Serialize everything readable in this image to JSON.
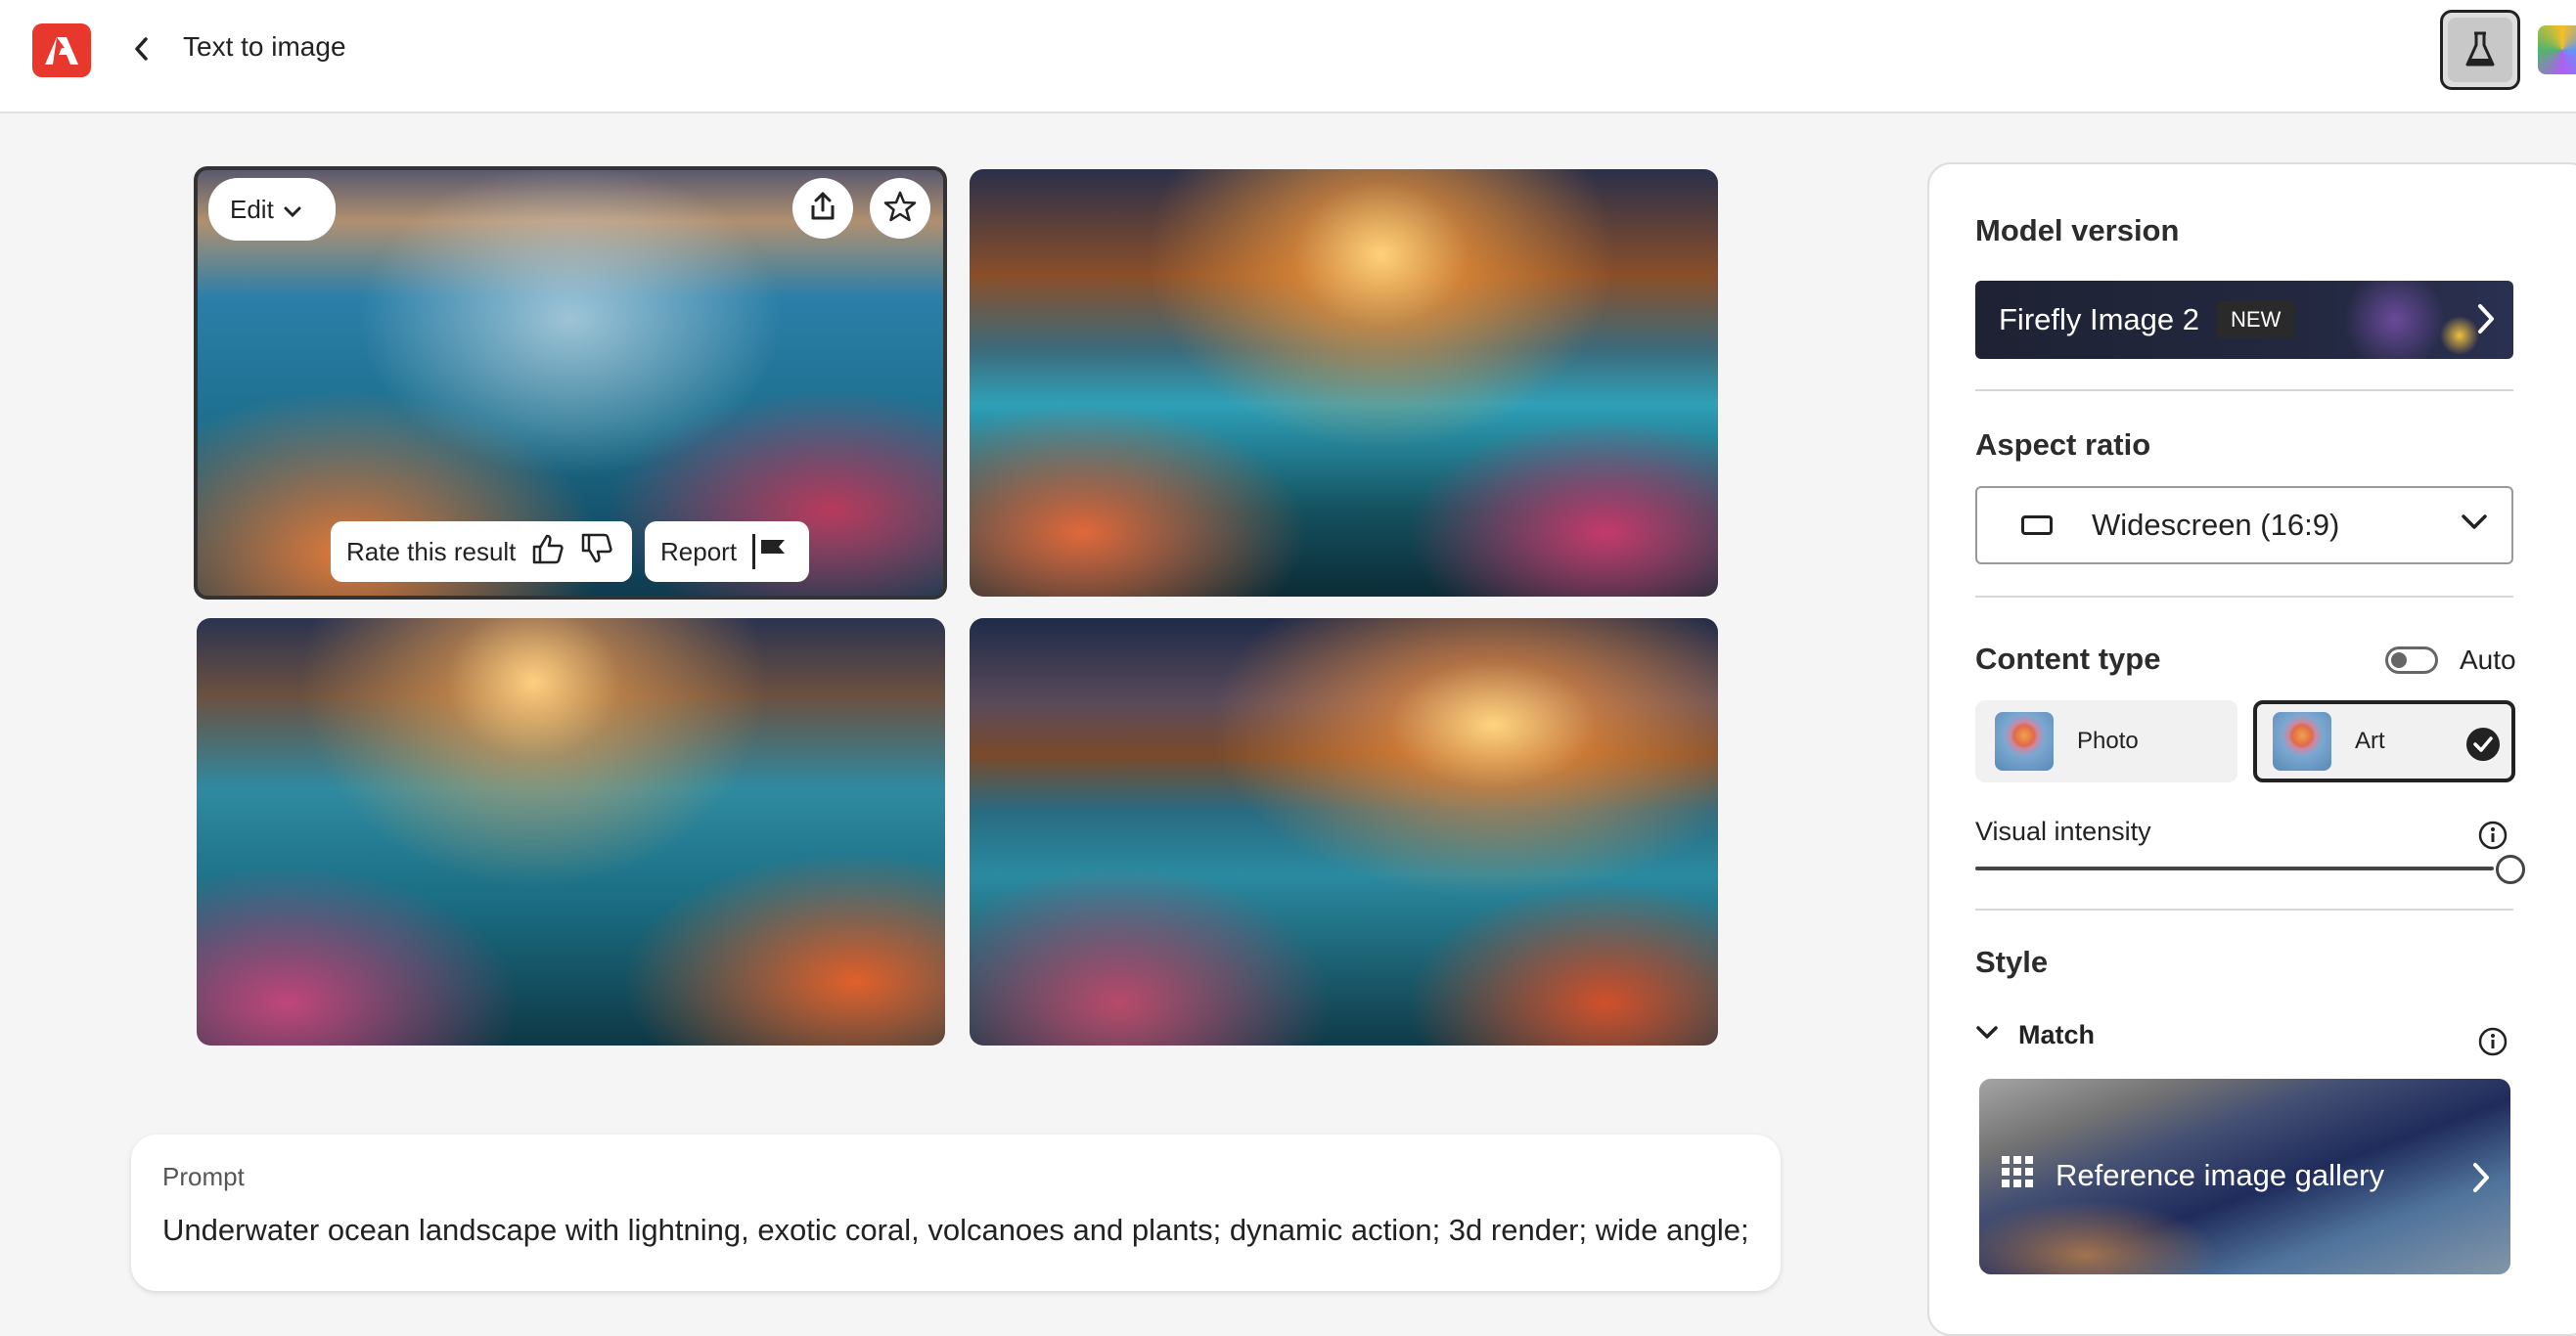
{
  "header": {
    "title": "Text to image"
  },
  "images": {
    "edit_label": "Edit",
    "rate_label": "Rate this result",
    "report_label": "Report"
  },
  "prompt": {
    "label": "Prompt",
    "text": "Underwater ocean landscape with lightning, exotic coral, volcanoes and plants; dynamic action; 3d render; wide angle;"
  },
  "panel": {
    "model_version": {
      "title": "Model version",
      "value": "Firefly Image 2",
      "badge": "NEW"
    },
    "aspect_ratio": {
      "title": "Aspect ratio",
      "value": "Widescreen (16:9)"
    },
    "content_type": {
      "title": "Content type",
      "auto_label": "Auto",
      "auto_enabled": false,
      "options": [
        {
          "label": "Photo",
          "selected": false
        },
        {
          "label": "Art",
          "selected": true
        }
      ]
    },
    "visual_intensity": {
      "label": "Visual intensity",
      "level": 1.0
    },
    "style": {
      "title": "Style",
      "match_label": "Match",
      "gallery_label": "Reference image gallery"
    }
  },
  "colors": {
    "brand": "#e8372c",
    "dark": "#222222"
  }
}
